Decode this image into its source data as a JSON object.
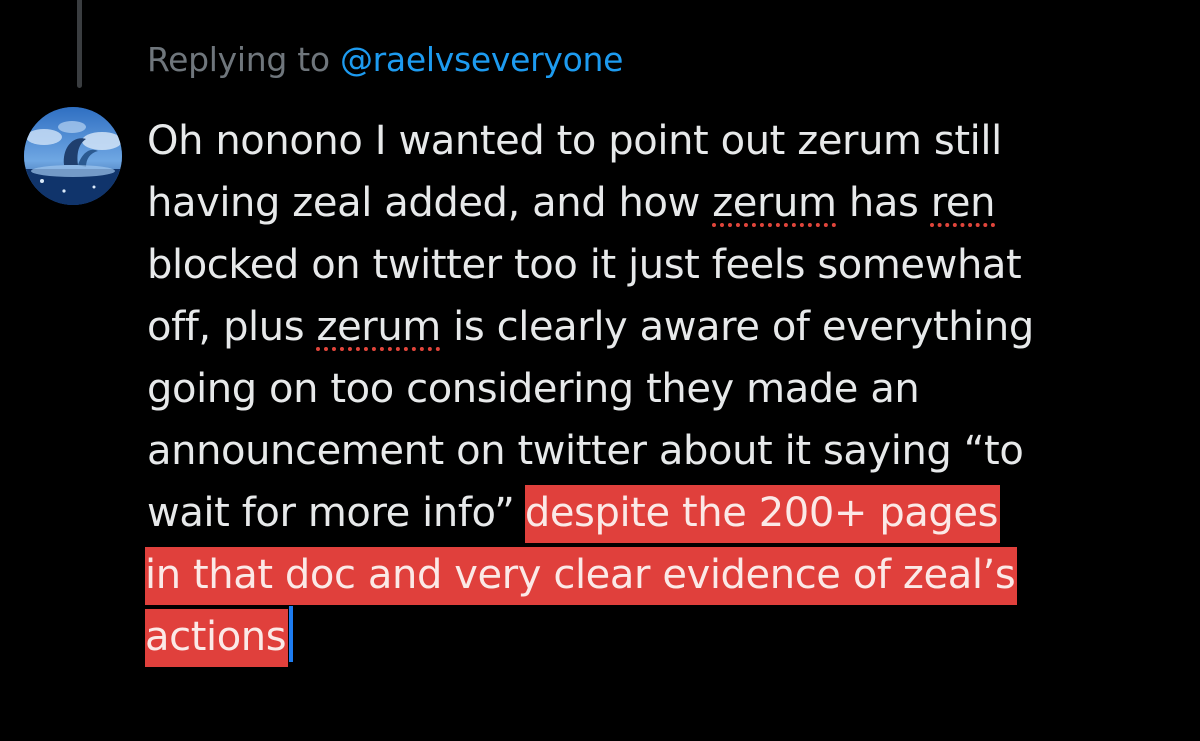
{
  "reply": {
    "prefix": "Replying to",
    "handle": "@raelvseveryone"
  },
  "avatar": {
    "icon": "whale-ocean-avatar-icon"
  },
  "tweet": {
    "lines": [
      "Oh nonono I wanted to point out zerum still",
      "having zeal added, and how ",
      "zerum",
      " has ",
      "ren",
      "blocked on twitter too it just feels somewhat",
      "off, plus ",
      "zerum",
      " is clearly aware of everything",
      "going on too considering they made an",
      "announcement on twitter about it saying “to",
      "wait for more info” ",
      "despite the 200+ pages",
      "in that doc and very clear evidence of zeal’s",
      "actions"
    ]
  },
  "colors": {
    "background": "#000000",
    "text": "#e7e9ea",
    "muted": "#6f767c",
    "link": "#1d9bf0",
    "highlight": "#e0403c",
    "caret": "#1d7cf0"
  }
}
